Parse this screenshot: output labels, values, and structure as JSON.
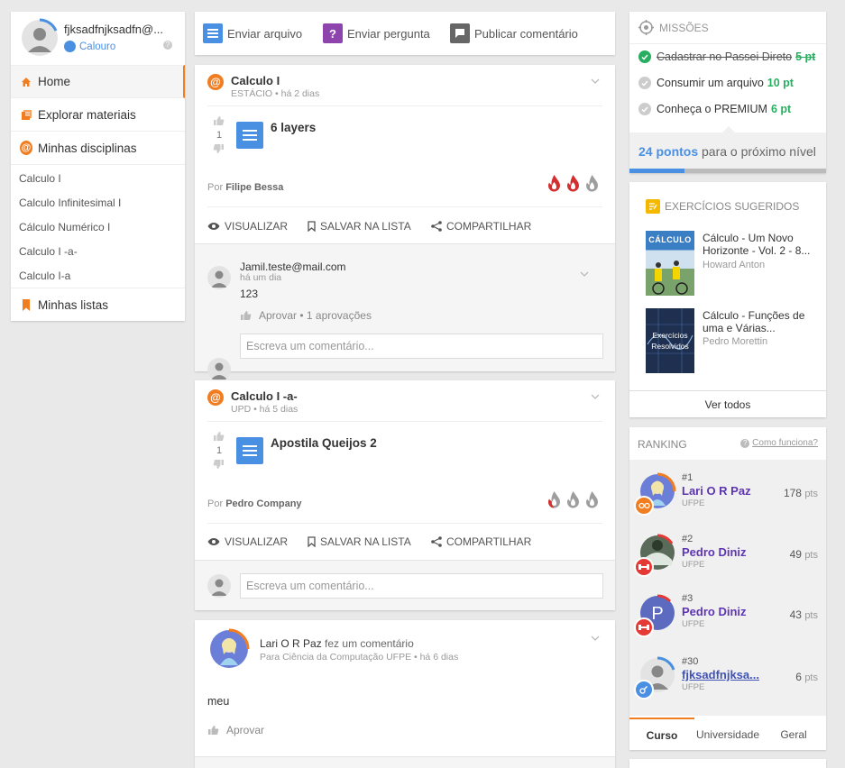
{
  "user": {
    "name": "fjksadfnjksadfn@...",
    "level": "Calouro"
  },
  "sidebar": {
    "home": "Home",
    "explore": "Explorar materiais",
    "my_subjects": "Minhas disciplinas",
    "subjects": [
      "Calculo I",
      "Calculo Infinitesimal I",
      "Cálculo Numérico I",
      "Calculo I -a-",
      "Calculo I-a"
    ],
    "my_lists": "Minhas listas"
  },
  "toolbar": {
    "send_file": "Enviar arquivo",
    "send_question": "Enviar pergunta",
    "publish_comment": "Publicar comentário"
  },
  "actions": {
    "view": "VISUALIZAR",
    "save": "SALVAR NA LISTA",
    "share": "COMPARTILHAR"
  },
  "post1": {
    "subject": "Calculo I",
    "meta": "ESTÁCIO • há 2 dias",
    "votes": "1",
    "doc_title": "6 layers",
    "by_prefix": "Por",
    "author": "Filipe Bessa",
    "comment": {
      "author": "Jamil.teste@mail.com",
      "time": "há um dia",
      "text": "123",
      "approve": "Aprovar",
      "approvals": "• 1 aprovações"
    },
    "comment_placeholder": "Escreva um comentário..."
  },
  "post2": {
    "subject": "Calculo I -a-",
    "meta": "UPD • há 5 dias",
    "votes": "1",
    "doc_title": "Apostila Queijos 2",
    "by_prefix": "Por",
    "author": "Pedro Company",
    "comment_placeholder": "Escreva um comentário..."
  },
  "post3": {
    "author": "Lari O R Paz",
    "action": "fez um comentário",
    "meta": "Para Ciência da Computação UFPE • há 6 dias",
    "text": "meu",
    "approve": "Aprovar"
  },
  "missions": {
    "title": "MISSÕES",
    "items": [
      {
        "label": "Cadastrar no Passei Direto",
        "pts": "5 pt"
      },
      {
        "label": "Consumir um arquivo",
        "pts": "10 pt"
      },
      {
        "label": "Conheça o PREMIUM",
        "pts": "6 pt"
      }
    ],
    "progress_points": "24 pontos",
    "progress_text": "para o próximo nível",
    "progress_fraction": 0.28
  },
  "suggested": {
    "title": "EXERCÍCIOS SUGERIDOS",
    "books": [
      {
        "cover": "CÁLCULO",
        "title": "Cálculo - Um Novo Horizonte - Vol. 2 - 8...",
        "author": "Howard Anton"
      },
      {
        "cover": "Exercícios Resolvidos",
        "title": "Cálculo - Funções de uma e Várias...",
        "author": "Pedro Morettin"
      }
    ],
    "see_all": "Ver todos"
  },
  "ranking": {
    "title": "RANKING",
    "how": "Como funciona?",
    "rows": [
      {
        "pos": "#1",
        "name": "Lari O R Paz",
        "uni": "UFPE",
        "pts": "178",
        "unit": "pts"
      },
      {
        "pos": "#2",
        "name": "Pedro Diniz",
        "uni": "UFPE",
        "pts": "49",
        "unit": "pts"
      },
      {
        "pos": "#3",
        "name": "Pedro Diniz",
        "uni": "UFPE",
        "pts": "43",
        "unit": "pts"
      },
      {
        "pos": "#30",
        "name": "fjksadfnjksa...",
        "uni": "UFPE",
        "pts": "6",
        "unit": "pts"
      }
    ],
    "tabs": [
      "Curso",
      "Universidade",
      "Geral"
    ]
  },
  "colors": {
    "orange": "#f17d21",
    "blue": "#4a90e2",
    "green": "#27ae60",
    "purple": "#5e35b1",
    "red": "#e53935"
  }
}
